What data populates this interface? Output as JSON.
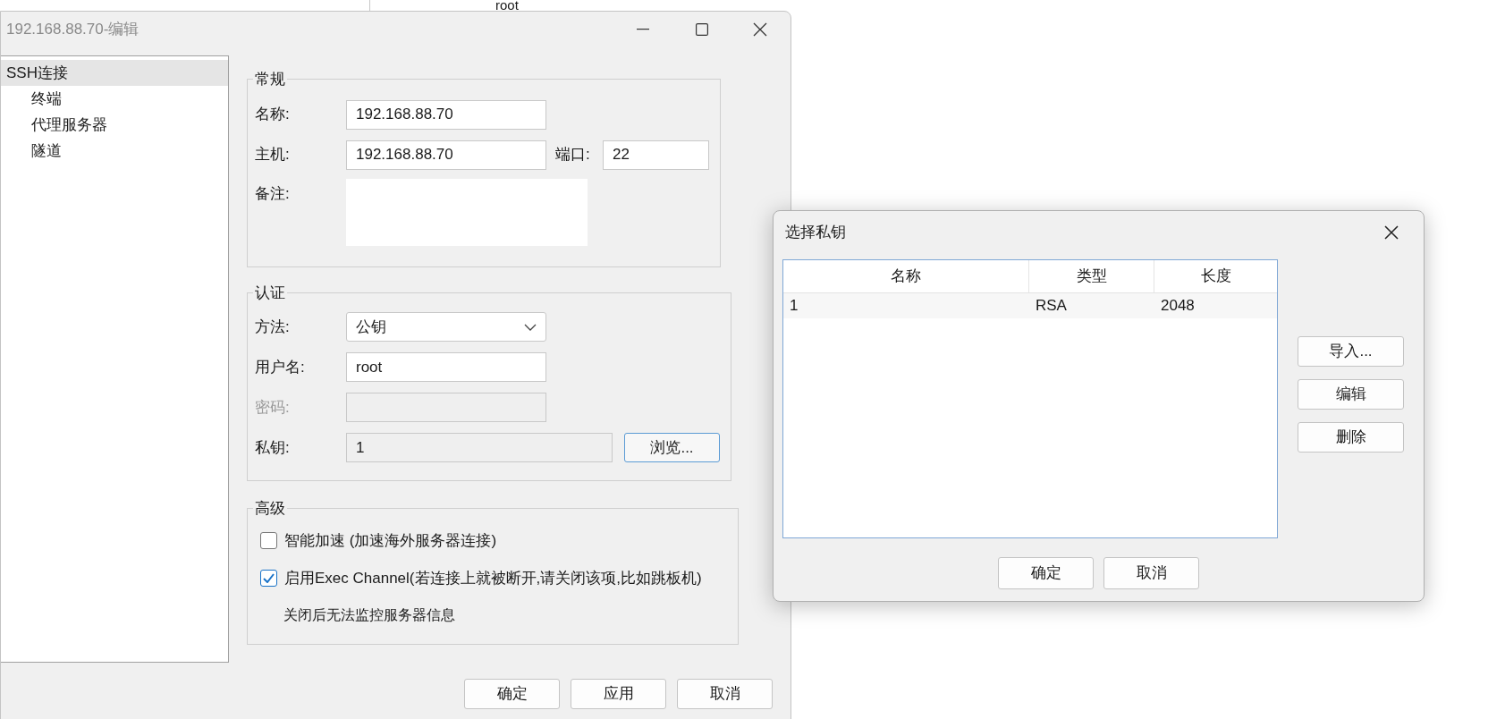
{
  "background_window": {
    "text": "root"
  },
  "edit_dialog": {
    "title": "192.168.88.70-编辑",
    "tree": [
      {
        "label": "SSH连接",
        "selected": true,
        "children": [
          {
            "label": "终端",
            "selected": false
          },
          {
            "label": "代理服务器",
            "selected": false
          },
          {
            "label": "隧道",
            "selected": false
          }
        ]
      }
    ],
    "general": {
      "title": "常规",
      "name_label": "名称:",
      "name_value": "192.168.88.70",
      "host_label": "主机:",
      "host_value": "192.168.88.70",
      "port_label": "端口:",
      "port_value": "22",
      "note_label": "备注:"
    },
    "auth": {
      "title": "认证",
      "method_label": "方法:",
      "method_value": "公钥",
      "username_label": "用户名:",
      "username_value": "root",
      "password_label": "密码:",
      "password_disabled": true,
      "key_label": "私钥:",
      "key_value": "1",
      "key_readonly": true,
      "browse_button": "浏览..."
    },
    "advanced": {
      "title": "高级",
      "options": [
        {
          "label": "智能加速 (加速海外服务器连接)",
          "checked": false
        },
        {
          "label": "启用Exec Channel(若连接上就被断开,请关闭该项,比如跳板机)",
          "checked": true
        }
      ],
      "note": "关闭后无法监控服务器信息"
    },
    "buttons": [
      "确定",
      "应用",
      "取消"
    ]
  },
  "key_dialog": {
    "title": "选择私钥",
    "table": {
      "columns": [
        "名称",
        "类型",
        "长度"
      ],
      "rows": [
        {
          "cells": [
            "1",
            "RSA",
            "2048"
          ]
        }
      ]
    },
    "side_buttons": [
      "导入...",
      "编辑",
      "删除"
    ],
    "buttons": [
      "确定",
      "取消"
    ]
  }
}
